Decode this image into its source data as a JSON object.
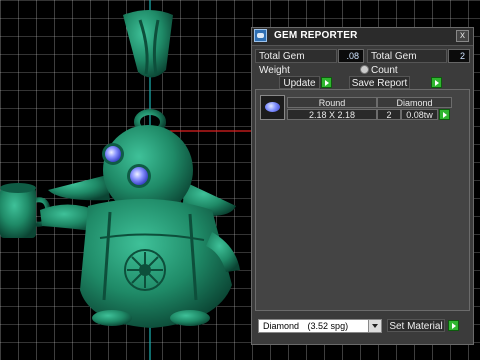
{
  "panel": {
    "title": "GEM REPORTER",
    "close_label": "x",
    "total_weight_label": "Total Gem Weight",
    "total_weight_value": ".08",
    "total_count_label": "Total Gem Count",
    "total_count_value": "2",
    "update_label": "Update",
    "save_report_label": "Save Report"
  },
  "gem_row": {
    "shape": "Round",
    "material": "Diamond",
    "size": "2.18 X 2.18",
    "count": "2",
    "weight": "0.08tw"
  },
  "material_select": {
    "value": "Diamond",
    "spg": "(3.52 spg)"
  },
  "set_material_label": "Set Material",
  "viewport": {
    "model_color": "#1f8a67",
    "gem_color": "#8a93ff",
    "grid_color": "#d8d8d8"
  }
}
